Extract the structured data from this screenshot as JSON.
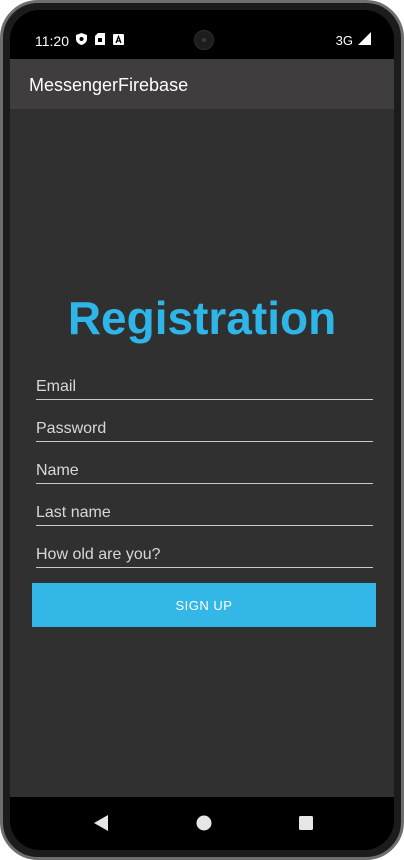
{
  "status_bar": {
    "time": "11:20",
    "network": "3G"
  },
  "icons": {
    "status_left": [
      "shield-icon",
      "sim-card-icon",
      "keyboard-a-icon"
    ],
    "status_right": [
      "signal-icon"
    ],
    "nav": [
      "back-icon",
      "home-icon",
      "recents-icon"
    ]
  },
  "app_bar": {
    "title": "MessengerFirebase"
  },
  "form": {
    "title": "Registration",
    "email_placeholder": "Email",
    "password_placeholder": "Password",
    "name_placeholder": "Name",
    "last_name_placeholder": "Last name",
    "age_placeholder": "How old are you?",
    "signup_label": "SIGN UP"
  },
  "colors": {
    "accent": "#33b7e7",
    "title": "#2fb6e8",
    "app_bar": "#3f3d3e",
    "background": "#303030"
  }
}
